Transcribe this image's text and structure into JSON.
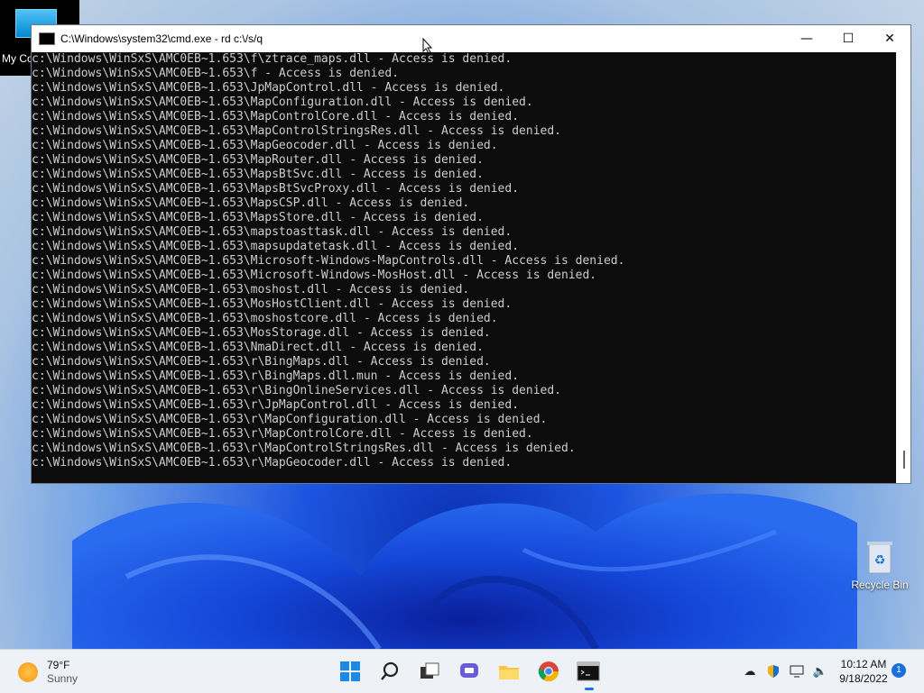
{
  "desktop": {
    "my_computer_label": "My Co",
    "recycle_bin_label": "Recycle Bin"
  },
  "window": {
    "title": "C:\\Windows\\system32\\cmd.exe - rd  c:\\/s/q",
    "minimize_label": "—",
    "maximize_label": "☐",
    "close_label": "✕"
  },
  "console": {
    "lines": [
      "c:\\Windows\\WinSxS\\AMC0EB~1.653\\f\\ztrace_maps.dll - Access is denied.",
      "c:\\Windows\\WinSxS\\AMC0EB~1.653\\f - Access is denied.",
      "c:\\Windows\\WinSxS\\AMC0EB~1.653\\JpMapControl.dll - Access is denied.",
      "c:\\Windows\\WinSxS\\AMC0EB~1.653\\MapConfiguration.dll - Access is denied.",
      "c:\\Windows\\WinSxS\\AMC0EB~1.653\\MapControlCore.dll - Access is denied.",
      "c:\\Windows\\WinSxS\\AMC0EB~1.653\\MapControlStringsRes.dll - Access is denied.",
      "c:\\Windows\\WinSxS\\AMC0EB~1.653\\MapGeocoder.dll - Access is denied.",
      "c:\\Windows\\WinSxS\\AMC0EB~1.653\\MapRouter.dll - Access is denied.",
      "c:\\Windows\\WinSxS\\AMC0EB~1.653\\MapsBtSvc.dll - Access is denied.",
      "c:\\Windows\\WinSxS\\AMC0EB~1.653\\MapsBtSvcProxy.dll - Access is denied.",
      "c:\\Windows\\WinSxS\\AMC0EB~1.653\\MapsCSP.dll - Access is denied.",
      "c:\\Windows\\WinSxS\\AMC0EB~1.653\\MapsStore.dll - Access is denied.",
      "c:\\Windows\\WinSxS\\AMC0EB~1.653\\mapstoasttask.dll - Access is denied.",
      "c:\\Windows\\WinSxS\\AMC0EB~1.653\\mapsupdatetask.dll - Access is denied.",
      "c:\\Windows\\WinSxS\\AMC0EB~1.653\\Microsoft-Windows-MapControls.dll - Access is denied.",
      "c:\\Windows\\WinSxS\\AMC0EB~1.653\\Microsoft-Windows-MosHost.dll - Access is denied.",
      "c:\\Windows\\WinSxS\\AMC0EB~1.653\\moshost.dll - Access is denied.",
      "c:\\Windows\\WinSxS\\AMC0EB~1.653\\MosHostClient.dll - Access is denied.",
      "c:\\Windows\\WinSxS\\AMC0EB~1.653\\moshostcore.dll - Access is denied.",
      "c:\\Windows\\WinSxS\\AMC0EB~1.653\\MosStorage.dll - Access is denied.",
      "c:\\Windows\\WinSxS\\AMC0EB~1.653\\NmaDirect.dll - Access is denied.",
      "c:\\Windows\\WinSxS\\AMC0EB~1.653\\r\\BingMaps.dll - Access is denied.",
      "c:\\Windows\\WinSxS\\AMC0EB~1.653\\r\\BingMaps.dll.mun - Access is denied.",
      "c:\\Windows\\WinSxS\\AMC0EB~1.653\\r\\BingOnlineServices.dll - Access is denied.",
      "c:\\Windows\\WinSxS\\AMC0EB~1.653\\r\\JpMapControl.dll - Access is denied.",
      "c:\\Windows\\WinSxS\\AMC0EB~1.653\\r\\MapConfiguration.dll - Access is denied.",
      "c:\\Windows\\WinSxS\\AMC0EB~1.653\\r\\MapControlCore.dll - Access is denied.",
      "c:\\Windows\\WinSxS\\AMC0EB~1.653\\r\\MapControlStringsRes.dll - Access is denied.",
      "c:\\Windows\\WinSxS\\AMC0EB~1.653\\r\\MapGeocoder.dll - Access is denied."
    ]
  },
  "taskbar": {
    "weather_temp": "79°F",
    "weather_condition": "Sunny",
    "apps": [
      "start-icon",
      "search-icon",
      "task-view-icon",
      "chat-icon",
      "file-explorer-icon",
      "chrome-icon",
      "terminal-icon"
    ],
    "tray_icons": [
      "onedrive-icon",
      "security-icon",
      "network-icon",
      "volume-icon"
    ],
    "clock_time": "10:12 AM",
    "clock_date": "9/18/2022",
    "notification_count": "1"
  },
  "colors": {
    "console_bg": "#0c0c0c",
    "console_text": "#cccccc",
    "accent": "#1a73e8"
  }
}
